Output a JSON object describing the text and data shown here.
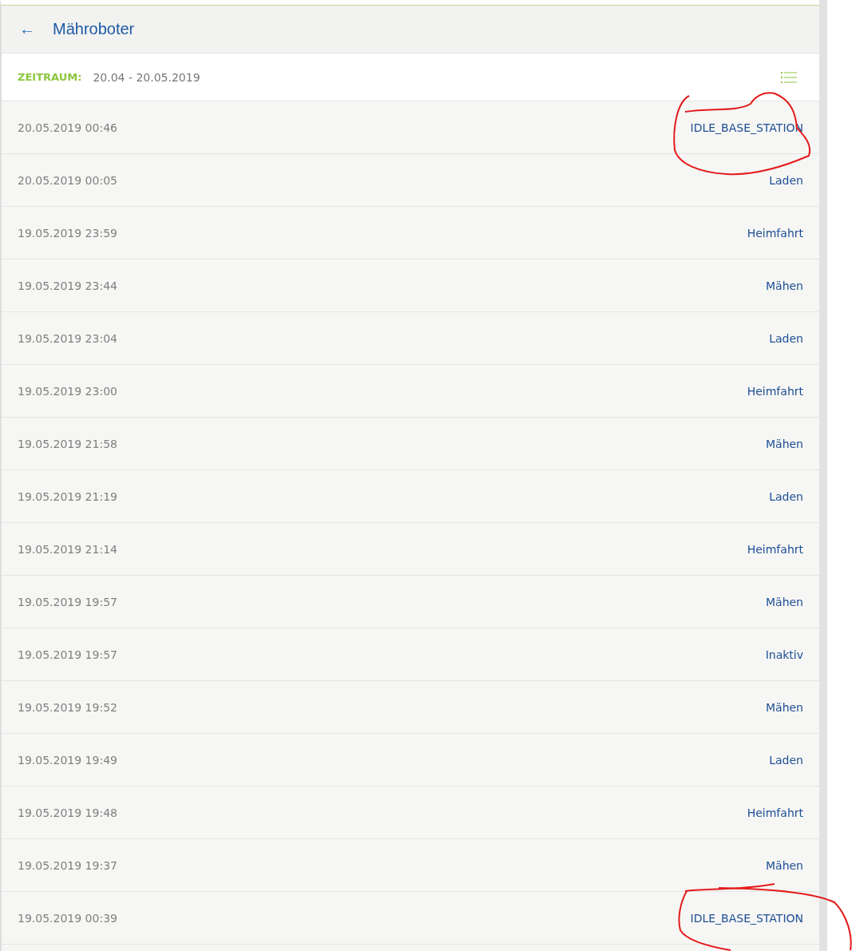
{
  "header": {
    "back_icon": "←",
    "title": "Mähroboter"
  },
  "filter": {
    "label": "ZEITRAUM:",
    "value": "20.04 - 20.05.2019"
  },
  "rows": [
    {
      "time": "20.05.2019 00:46",
      "status": "IDLE_BASE_STATION"
    },
    {
      "time": "20.05.2019 00:05",
      "status": "Laden"
    },
    {
      "time": "19.05.2019 23:59",
      "status": "Heimfahrt"
    },
    {
      "time": "19.05.2019 23:44",
      "status": "Mähen"
    },
    {
      "time": "19.05.2019 23:04",
      "status": "Laden"
    },
    {
      "time": "19.05.2019 23:00",
      "status": "Heimfahrt"
    },
    {
      "time": "19.05.2019 21:58",
      "status": "Mähen"
    },
    {
      "time": "19.05.2019 21:19",
      "status": "Laden"
    },
    {
      "time": "19.05.2019 21:14",
      "status": "Heimfahrt"
    },
    {
      "time": "19.05.2019 19:57",
      "status": "Mähen"
    },
    {
      "time": "19.05.2019 19:57",
      "status": "Inaktiv"
    },
    {
      "time": "19.05.2019 19:52",
      "status": "Mähen"
    },
    {
      "time": "19.05.2019 19:49",
      "status": "Laden"
    },
    {
      "time": "19.05.2019 19:48",
      "status": "Heimfahrt"
    },
    {
      "time": "19.05.2019 19:37",
      "status": "Mähen"
    },
    {
      "time": "19.05.2019 00:39",
      "status": "IDLE_BASE_STATION"
    }
  ]
}
